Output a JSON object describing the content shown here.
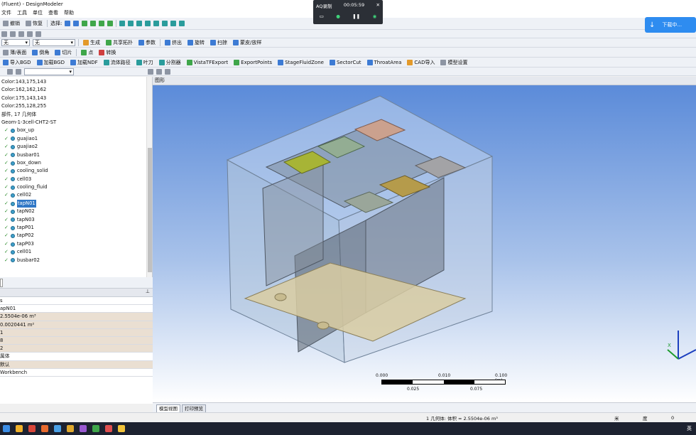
{
  "window": {
    "title": "(Fluent)  - DesignModeler"
  },
  "menu": [
    "文件",
    "工具",
    "单位",
    "查看",
    "帮助"
  ],
  "toolbar1": {
    "undo": "撤销",
    "redo": "恢复",
    "select_label": "选择:"
  },
  "toolbar2": {
    "plane_combo": "无",
    "extra": "无"
  },
  "toolbar3": {
    "generate": "生成",
    "share_topology": "共享拓扑",
    "params": "参数",
    "extrude": "挤出",
    "revolve": "旋转",
    "sweep": "扫掠",
    "skin_loft": "蒙皮/放样"
  },
  "toolbar4": {
    "thin": "薄/表面",
    "blend": "倒角",
    "chamfer": "切片",
    "point": "点",
    "convert": "转换"
  },
  "toolbar5": [
    "导入BGD",
    "加载BGD",
    "加载NDF",
    "流体路径",
    "叶刀",
    "分割器",
    "VistaTFExport",
    "ExportPoints",
    "StageFluidZone",
    "SectorCut",
    "ThroatArea",
    "CAD导入",
    "模型设置"
  ],
  "recorder": {
    "title": "AQ录制",
    "time": "00:05:59"
  },
  "notify": {
    "label": "下载中..."
  },
  "tree": {
    "items": [
      {
        "label": "Color:143,175,143",
        "kind": "text"
      },
      {
        "label": "Color:162,162,162",
        "kind": "text"
      },
      {
        "label": "Color:175,143,143",
        "kind": "text"
      },
      {
        "label": "Color:255,128,255",
        "kind": "text"
      },
      {
        "label": "部件, 17 几何体",
        "kind": "text"
      },
      {
        "label": "Geom-1-3cell-CHT2-ST",
        "kind": "text"
      },
      {
        "label": "box_up",
        "kind": "body"
      },
      {
        "label": "guajiao1",
        "kind": "body"
      },
      {
        "label": "guajiao2",
        "kind": "body"
      },
      {
        "label": "busbar01",
        "kind": "body"
      },
      {
        "label": "box_down",
        "kind": "body"
      },
      {
        "label": "cooling_solid",
        "kind": "body"
      },
      {
        "label": "cell03",
        "kind": "body"
      },
      {
        "label": "cooling_fluid",
        "kind": "body"
      },
      {
        "label": "cell02",
        "kind": "body"
      },
      {
        "label": "tapN01",
        "kind": "body",
        "selected": true
      },
      {
        "label": "tapN02",
        "kind": "body"
      },
      {
        "label": "tapN03",
        "kind": "body"
      },
      {
        "label": "tapP01",
        "kind": "body"
      },
      {
        "label": "tapP02",
        "kind": "body"
      },
      {
        "label": "tapP03",
        "kind": "body"
      },
      {
        "label": "cell01",
        "kind": "body"
      },
      {
        "label": "busbar02",
        "kind": "body"
      }
    ]
  },
  "details": {
    "rows": [
      {
        "a": "s"
      },
      {
        "a": "apN01"
      },
      {
        "a": "2.5504e-06 m³",
        "shade": true
      },
      {
        "a": "0.0020441 m²",
        "shade": true
      },
      {
        "a": "1",
        "shade": true
      },
      {
        "a": "8",
        "shade": true
      },
      {
        "a": "2",
        "shade": true
      },
      {
        "a": "属体"
      },
      {
        "a": "默认",
        "shade": true
      },
      {
        "a": "Workbench"
      }
    ]
  },
  "graphics": {
    "header": "图形",
    "scale": {
      "t0": "0.000",
      "t1": "0.010",
      "t2": "0.100 (m)",
      "b1": "0.025",
      "b2": "0.075"
    },
    "triad_label": "X"
  },
  "bottom_tabs": [
    "模型视图",
    "打印预览"
  ],
  "status": {
    "selection": "1 几何体: 体积 = 2.5504e-06 m³",
    "unit": "米",
    "unit2": "度",
    "value": "0"
  },
  "taskbar": {
    "lang": "英"
  },
  "colors": {
    "accent": "#3178c6",
    "viewport_top": "#5b8bd9",
    "viewport_bottom": "#ffffff"
  }
}
